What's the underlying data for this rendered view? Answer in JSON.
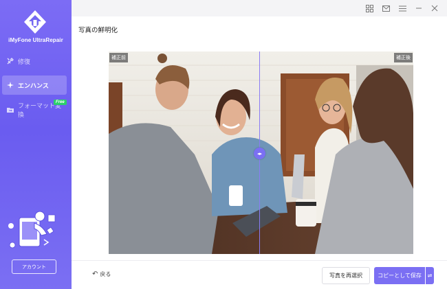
{
  "app": {
    "name": "iMyFone UltraRepair"
  },
  "sidebar": {
    "items": [
      {
        "label": "修復",
        "icon": "wrench-icon"
      },
      {
        "label": "エンハンス",
        "icon": "sparkle-icon",
        "active": true
      },
      {
        "label": "フォーマット変換",
        "icon": "folder-convert-icon",
        "badge": "Free"
      }
    ],
    "account_label": "アカウント"
  },
  "window_controls": [
    "grid-icon",
    "mail-icon",
    "menu-icon",
    "minimize-icon",
    "close-icon"
  ],
  "page": {
    "title": "写真の鮮明化"
  },
  "preview": {
    "before_label": "補正前",
    "after_label": "補正後"
  },
  "footer": {
    "back_label": "戻る",
    "reselect_label": "写真を再選択",
    "save_label": "コピーとして保存",
    "compare_glyph": "⇌"
  },
  "colors": {
    "accent": "#7b6ff3",
    "badge": "#2ccf6a"
  }
}
